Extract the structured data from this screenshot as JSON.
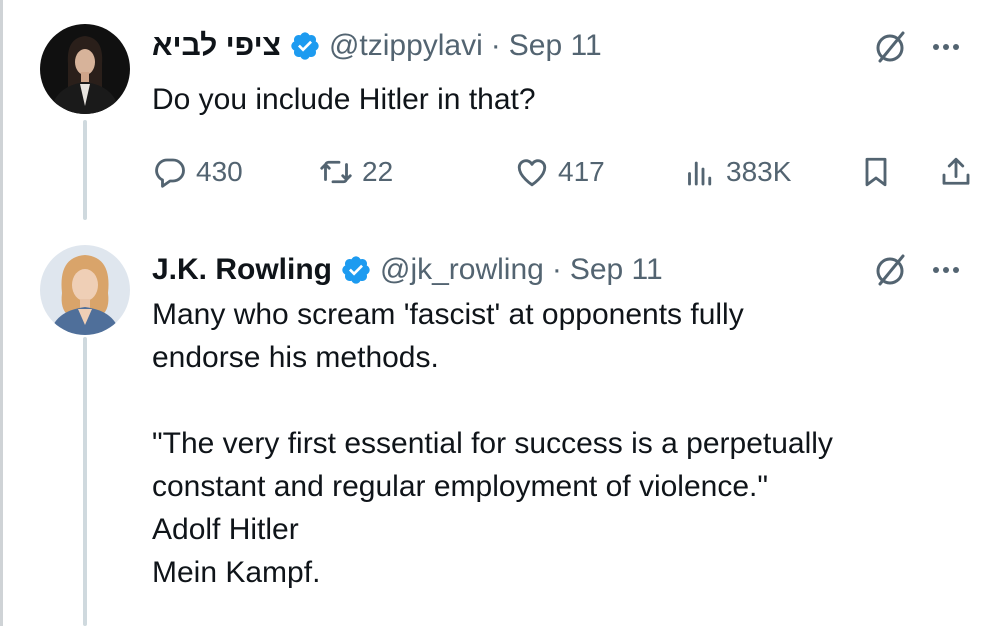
{
  "tweets": [
    {
      "display_name": "ציפי לביא",
      "handle": "@tzippylavi",
      "separator": "·",
      "date": "Sep 11",
      "verified": true,
      "lines": [
        "Do you include Hitler in that?"
      ],
      "stats": {
        "replies": "430",
        "reposts": "22",
        "likes": "417",
        "views": "383K"
      }
    },
    {
      "display_name": "J.K. Rowling",
      "handle": "@jk_rowling",
      "separator": "·",
      "date": "Sep 11",
      "verified": true,
      "lines": [
        "Many who scream 'fascist' at opponents fully",
        "endorse his methods.",
        "",
        "\"The very first essential for success is a perpetually",
        "constant and regular employment of violence.\"",
        "Adolf Hitler",
        "Mein Kampf."
      ]
    }
  ],
  "colors": {
    "text_primary": "#0f1419",
    "text_secondary": "#536471",
    "verified_blue": "#1d9bf0",
    "thread_line": "#cfd9de"
  },
  "icons": [
    "verified-badge-icon",
    "grok-icon",
    "more-icon",
    "reply-icon",
    "repost-icon",
    "like-icon",
    "views-icon",
    "bookmark-icon",
    "share-icon"
  ]
}
